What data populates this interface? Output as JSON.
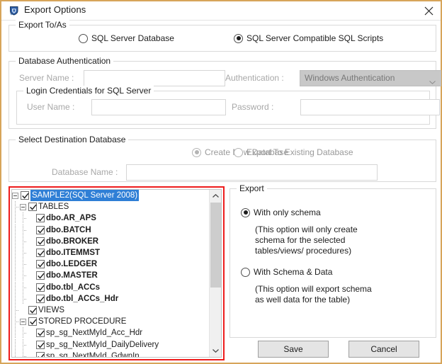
{
  "window": {
    "title": "Export Options",
    "icon": "shield-app-icon",
    "close_icon": "close-icon",
    "border_color": "#d7a55a"
  },
  "export_to_as": {
    "legend": "Export To/As",
    "options": [
      {
        "label": "SQL Server Database",
        "selected": false
      },
      {
        "label": "SQL Server Compatible SQL Scripts",
        "selected": true
      }
    ]
  },
  "database_authentication": {
    "legend": "Database Authentication",
    "server_name_label": "Server Name :",
    "server_name_value": "",
    "authentication_label": "Authentication :",
    "authentication_value": "Windows Authentication",
    "login_credentials": {
      "legend": "Login Credentials for SQL Server",
      "user_name_label": "User Name :",
      "user_name_value": "",
      "password_label": "Password :",
      "password_value": ""
    }
  },
  "select_destination_database": {
    "legend": "Select Destination Database",
    "options": [
      {
        "label": "Create New Database",
        "selected": true
      },
      {
        "label": "Export To Existing Database",
        "selected": false
      }
    ],
    "database_name_label": "Database Name :",
    "database_name_value": ""
  },
  "tree": {
    "highlight_color": "#ee1c1c",
    "selected_color": "#2f7fd6",
    "scrollbar": {
      "up_icon": "chevron-up-icon",
      "down_icon": "chevron-down-icon"
    },
    "items": [
      {
        "label": "SAMPLE2(SQL Server 2008)",
        "depth": 0,
        "expander": "minus",
        "checked": true,
        "bold": false,
        "selected": true
      },
      {
        "label": "TABLES",
        "depth": 1,
        "expander": "minus",
        "checked": true,
        "bold": false,
        "selected": false
      },
      {
        "label": "dbo.AR_APS",
        "depth": 2,
        "expander": "none",
        "checked": true,
        "bold": true,
        "selected": false
      },
      {
        "label": "dbo.BATCH",
        "depth": 2,
        "expander": "none",
        "checked": true,
        "bold": true,
        "selected": false
      },
      {
        "label": "dbo.BROKER",
        "depth": 2,
        "expander": "none",
        "checked": true,
        "bold": true,
        "selected": false
      },
      {
        "label": "dbo.ITEMMST",
        "depth": 2,
        "expander": "none",
        "checked": true,
        "bold": true,
        "selected": false
      },
      {
        "label": "dbo.LEDGER",
        "depth": 2,
        "expander": "none",
        "checked": true,
        "bold": true,
        "selected": false
      },
      {
        "label": "dbo.MASTER",
        "depth": 2,
        "expander": "none",
        "checked": true,
        "bold": true,
        "selected": false
      },
      {
        "label": "dbo.tbl_ACCs",
        "depth": 2,
        "expander": "none",
        "checked": true,
        "bold": true,
        "selected": false
      },
      {
        "label": "dbo.tbl_ACCs_Hdr",
        "depth": 2,
        "expander": "none",
        "checked": true,
        "bold": true,
        "selected": false
      },
      {
        "label": "VIEWS",
        "depth": 1,
        "expander": "none",
        "checked": true,
        "bold": false,
        "selected": false
      },
      {
        "label": "STORED PROCEDURE",
        "depth": 1,
        "expander": "minus",
        "checked": true,
        "bold": false,
        "selected": false
      },
      {
        "label": "sp_sg_NextMyId_Acc_Hdr",
        "depth": 2,
        "expander": "none",
        "checked": true,
        "bold": false,
        "selected": false
      },
      {
        "label": "sp_sg_NextMyId_DailyDelivery",
        "depth": 2,
        "expander": "none",
        "checked": true,
        "bold": false,
        "selected": false
      },
      {
        "label": "sp_sg_NextMyId_GdwnIn",
        "depth": 2,
        "expander": "none",
        "checked": true,
        "bold": false,
        "selected": false
      }
    ]
  },
  "export": {
    "legend": "Export",
    "option1_label": "With only schema",
    "option1_selected": true,
    "option1_desc": "(This option will only create\nschema for the selected\ntables/views/ procedures)",
    "option2_label": "With Schema & Data",
    "option2_selected": false,
    "option2_desc": "(This option will export schema\nas well data for the table)"
  },
  "footer": {
    "save_label": "Save",
    "cancel_label": "Cancel"
  }
}
